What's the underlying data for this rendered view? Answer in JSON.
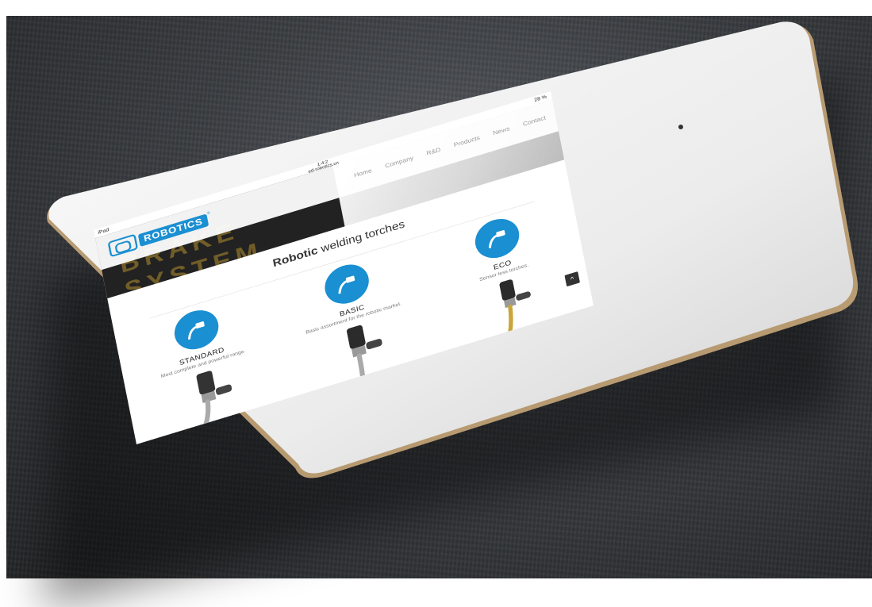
{
  "device": {
    "status_left": "iPad",
    "status_time": "1:4:2",
    "status_url": "ed-robotics.cn",
    "status_right": "28 %"
  },
  "brand": {
    "name": "ROBOTICS",
    "reg": "®",
    "accent": "#1a8fd1",
    "hero_text": "BRAKE SYSTEM"
  },
  "nav": {
    "items": [
      "Home",
      "Company",
      "R&D",
      "Products",
      "News",
      "Contact"
    ]
  },
  "section": {
    "title_bold": "Robotic",
    "title_rest": " welding torches"
  },
  "products": [
    {
      "name": "STANDARD",
      "desc": "Most complete and powerful range."
    },
    {
      "name": "BASIC",
      "desc": "Basic assortment for the robotic market."
    },
    {
      "name": "ECO",
      "desc": "Sensor less torches."
    }
  ],
  "scroll_top_label": "^"
}
